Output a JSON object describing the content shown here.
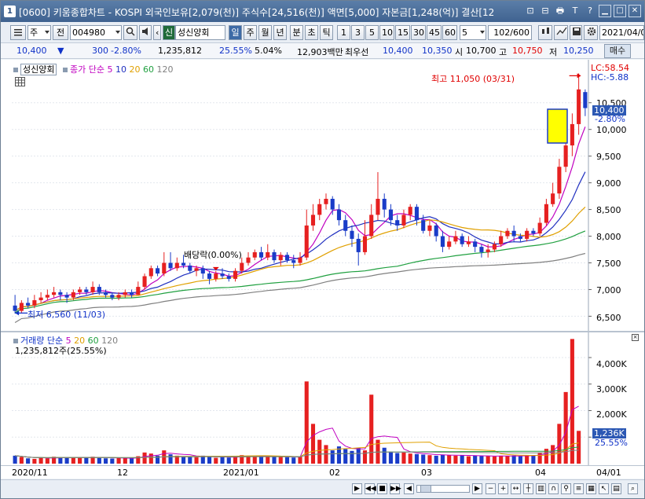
{
  "window": {
    "app_number": "1",
    "title": "[0600] 키움종합차트 - KOSPI 외국인보유[2,079(천)] 주식수[24,516(천)] 액면[5,000] 자본금[1,248(억)] 결산[12",
    "title_buttons": [
      "⊡",
      "⊟",
      "🖶",
      "T",
      "?"
    ]
  },
  "toolbar": {
    "market": "주",
    "view": "전",
    "code": "004980",
    "badge": "신",
    "stock_name": "성신양회",
    "periods": [
      "일",
      "주",
      "월",
      "년",
      "분",
      "초",
      "틱"
    ],
    "active_period": "일",
    "minute_options": [
      "1",
      "3",
      "5",
      "10",
      "15",
      "30",
      "45",
      "60"
    ],
    "minute_select": "5",
    "count": "102/600",
    "date": "2021/04/0"
  },
  "quote": {
    "price": "10,400",
    "change": "300",
    "change_pct": "-2.80%",
    "volume": "1,235,812",
    "volume_ratio": "25.55%",
    "turnover_pct": "5.04%",
    "amount": "12,903백만",
    "best_label": "최우선",
    "ask": "10,400",
    "bid": "10,350",
    "open_label": "시",
    "open": "10,700",
    "high_label": "고",
    "high": "10,750",
    "low_label": "저",
    "low": "10,250",
    "buy_button": "매수"
  },
  "price_panel": {
    "stock_label": "성신양회",
    "ma_label": "종가 단순",
    "ma_periods": [
      {
        "label": "5",
        "color": "#c000c0"
      },
      {
        "label": "10",
        "color": "#2030c0"
      },
      {
        "label": "20",
        "color": "#e0a000"
      },
      {
        "label": "60",
        "color": "#20a040"
      },
      {
        "label": "120",
        "color": "#808080"
      }
    ],
    "lc": "LC:58.54",
    "hc": "HC:-5.88",
    "high_annotation": "최고 11,050 (03/31)",
    "low_annotation": "최저 6,560 (11/03)",
    "dividend_annotation": "배당락(0.00%)",
    "y_labels": [
      "10,500",
      "10,000",
      "9,500",
      "9,000",
      "8,500",
      "8,000",
      "7,500",
      "7,000",
      "6,500"
    ],
    "current_tag": "10,400",
    "current_tag_pct": "-2.80%"
  },
  "volume_panel": {
    "label": "거래량",
    "ma_label": "단순",
    "ma_periods": [
      {
        "label": "5",
        "color": "#c000c0"
      },
      {
        "label": "20",
        "color": "#e0a000"
      },
      {
        "label": "60",
        "color": "#20a040"
      },
      {
        "label": "120",
        "color": "#808080"
      }
    ],
    "volume_text": "1,235,812주(25.55%)",
    "y_labels": [
      "4,000K",
      "3,000K",
      "2,000K",
      "1,000K"
    ],
    "current_tag": "1,236K",
    "current_pct": "25.55%"
  },
  "x_axis": {
    "labels": [
      "2020/11",
      "12",
      "2021/01",
      "02",
      "03",
      "04",
      "04/01"
    ]
  },
  "chart_data": {
    "type": "candlestick",
    "price_range": [
      6300,
      11100
    ],
    "volume_range": [
      0,
      4800
    ],
    "high_point": {
      "value": 11050,
      "date": "03/31"
    },
    "low_point": {
      "value": 6560,
      "date": "11/03"
    },
    "candles": [
      [
        6700,
        6600,
        6900,
        6550
      ],
      [
        6600,
        6750,
        6800,
        6550
      ],
      [
        6750,
        6700,
        6850,
        6650
      ],
      [
        6700,
        6800,
        6900,
        6650
      ],
      [
        6800,
        6850,
        6950,
        6750
      ],
      [
        6850,
        6900,
        7000,
        6800
      ],
      [
        6900,
        6950,
        7050,
        6850
      ],
      [
        6950,
        6900,
        7000,
        6800
      ],
      [
        6900,
        6850,
        6950,
        6750
      ],
      [
        6850,
        6950,
        7000,
        6800
      ],
      [
        6950,
        7000,
        7050,
        6900
      ],
      [
        7000,
        6950,
        7050,
        6900
      ],
      [
        6950,
        7050,
        7150,
        6900
      ],
      [
        7050,
        6950,
        7100,
        6900
      ],
      [
        6950,
        6900,
        7000,
        6850
      ],
      [
        6900,
        6850,
        6950,
        6800
      ],
      [
        6850,
        6900,
        6950,
        6800
      ],
      [
        6900,
        6950,
        7000,
        6850
      ],
      [
        6950,
        6900,
        7000,
        6850
      ],
      [
        6900,
        7050,
        7150,
        6900
      ],
      [
        7050,
        7250,
        7300,
        7000
      ],
      [
        7250,
        7400,
        7450,
        7200
      ],
      [
        7400,
        7300,
        7450,
        7250
      ],
      [
        7300,
        7500,
        7700,
        7250
      ],
      [
        7500,
        7400,
        7700,
        7350
      ],
      [
        7400,
        7500,
        7600,
        7350
      ],
      [
        7500,
        7450,
        7650,
        7400
      ],
      [
        7450,
        7350,
        7500,
        7300
      ],
      [
        7350,
        7400,
        7450,
        7250
      ],
      [
        7400,
        7300,
        7450,
        7200
      ],
      [
        7300,
        7200,
        7350,
        7100
      ],
      [
        7200,
        7300,
        7350,
        7150
      ],
      [
        7300,
        7250,
        7400,
        7200
      ],
      [
        7250,
        7200,
        7300,
        7150
      ],
      [
        7200,
        7350,
        7400,
        7150
      ],
      [
        7350,
        7500,
        7600,
        7300
      ],
      [
        7500,
        7600,
        7700,
        7450
      ],
      [
        7600,
        7700,
        7750,
        7550
      ],
      [
        7700,
        7600,
        7800,
        7550
      ],
      [
        7600,
        7700,
        7850,
        7550
      ],
      [
        7700,
        7550,
        7750,
        7500
      ],
      [
        7550,
        7650,
        7700,
        7450
      ],
      [
        7650,
        7550,
        7700,
        7500
      ],
      [
        7550,
        7500,
        7650,
        7400
      ],
      [
        7500,
        7600,
        7700,
        7450
      ],
      [
        7600,
        8200,
        8500,
        7550
      ],
      [
        8200,
        8400,
        8600,
        8100
      ],
      [
        8400,
        8600,
        8700,
        8300
      ],
      [
        8600,
        8700,
        8800,
        8500
      ],
      [
        8700,
        8500,
        8750,
        8400
      ],
      [
        8500,
        8300,
        8600,
        8200
      ],
      [
        8300,
        8100,
        8400,
        8000
      ],
      [
        8100,
        7950,
        8200,
        7800
      ],
      [
        7950,
        7700,
        8050,
        7450
      ],
      [
        7700,
        8000,
        8300,
        7650
      ],
      [
        8000,
        8400,
        8600,
        7950
      ],
      [
        8400,
        8700,
        9200,
        8300
      ],
      [
        8700,
        8500,
        8800,
        8350
      ],
      [
        8500,
        8300,
        8600,
        8200
      ],
      [
        8300,
        8200,
        8400,
        8100
      ],
      [
        8200,
        8400,
        8500,
        8150
      ],
      [
        8400,
        8550,
        8600,
        8300
      ],
      [
        8550,
        8300,
        8600,
        8200
      ],
      [
        8300,
        8100,
        8400,
        8050
      ],
      [
        8100,
        8200,
        8300,
        8000
      ],
      [
        8200,
        8000,
        8250,
        7900
      ],
      [
        8000,
        7800,
        8100,
        7700
      ],
      [
        7800,
        7900,
        8000,
        7750
      ],
      [
        7900,
        8000,
        8100,
        7850
      ],
      [
        8000,
        7850,
        8050,
        7800
      ],
      [
        7850,
        7900,
        8000,
        7800
      ],
      [
        7900,
        7800,
        7950,
        7700
      ],
      [
        7800,
        7700,
        7850,
        7600
      ],
      [
        7700,
        7750,
        7850,
        7600
      ],
      [
        7750,
        7850,
        7900,
        7700
      ],
      [
        7850,
        8000,
        8100,
        7800
      ],
      [
        8000,
        8100,
        8150,
        7950
      ],
      [
        8100,
        8000,
        8200,
        7900
      ],
      [
        8000,
        7950,
        8050,
        7900
      ],
      [
        7950,
        8100,
        8150,
        7900
      ],
      [
        8100,
        8050,
        8150,
        8000
      ],
      [
        8050,
        8250,
        8350,
        8000
      ],
      [
        8250,
        8600,
        8700,
        8200
      ],
      [
        8600,
        8800,
        9000,
        8550
      ],
      [
        8800,
        9300,
        9450,
        8700
      ],
      [
        9300,
        9700,
        9800,
        9200
      ],
      [
        9700,
        10100,
        10300,
        9500
      ],
      [
        10100,
        10750,
        11050,
        9900
      ],
      [
        10700,
        10400,
        10750,
        10250
      ]
    ],
    "volumes": [
      300,
      250,
      200,
      180,
      220,
      200,
      260,
      240,
      210,
      230,
      250,
      220,
      260,
      230,
      200,
      190,
      210,
      220,
      200,
      280,
      420,
      380,
      300,
      500,
      350,
      300,
      280,
      260,
      240,
      300,
      260,
      220,
      240,
      230,
      260,
      320,
      300,
      280,
      260,
      290,
      270,
      250,
      240,
      230,
      260,
      3100,
      1500,
      900,
      700,
      500,
      650,
      550,
      480,
      600,
      500,
      2600,
      900,
      600,
      450,
      400,
      420,
      380,
      360,
      340,
      320,
      300,
      340,
      320,
      300,
      310,
      280,
      300,
      290,
      280,
      270,
      300,
      290,
      310,
      280,
      300,
      320,
      420,
      560,
      700,
      1500,
      2700,
      4700,
      1236
    ]
  }
}
